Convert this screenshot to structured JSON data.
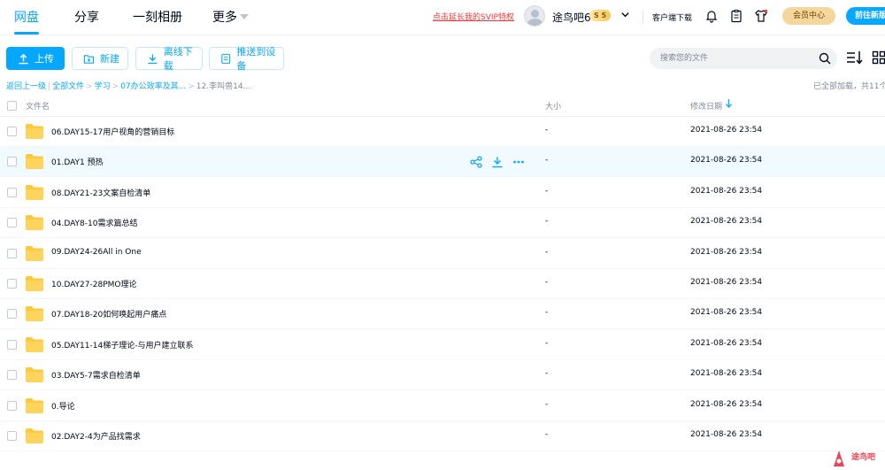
{
  "nav": {
    "items": [
      "网盘",
      "分享",
      "一刻相册",
      "更多"
    ],
    "promo": "点击延长我的SVIP特权",
    "username": "途鸟吧6",
    "vip_level": "5",
    "client_download": "客户端下载",
    "member_center": "会员中心",
    "go": "前往新版"
  },
  "toolbar": {
    "upload": "上传",
    "new": "新建",
    "offline": "离线下载",
    "push": "推送到设备",
    "search_placeholder": "搜索您的文件"
  },
  "breadcrumb": {
    "back": "返回上一级",
    "items": [
      "全部文件",
      "学习",
      "07办公效率及其..."
    ],
    "current": "12.李叫兽14...",
    "loaded": "已全部加载，共11个"
  },
  "table": {
    "headers": {
      "name": "文件名",
      "size": "大小",
      "date": "修改日期"
    },
    "rows": [
      {
        "name": "06.DAY15-17用户视角的营销目标",
        "size": "-",
        "date": "2021-08-26 23:54"
      },
      {
        "name": "01.DAY1 预热",
        "size": "-",
        "date": "2021-08-26 23:54"
      },
      {
        "name": "08.DAY21-23文案自检清单",
        "size": "-",
        "date": "2021-08-26 23:54"
      },
      {
        "name": "04.DAY8-10需求篇总结",
        "size": "-",
        "date": "2021-08-26 23:54"
      },
      {
        "name": "09.DAY24-26All in One",
        "size": "-",
        "date": "2021-08-26 23:54"
      },
      {
        "name": "10.DAY27-28PMO理论",
        "size": "-",
        "date": "2021-08-26 23:54"
      },
      {
        "name": "07.DAY18-20如何唤起用户痛点",
        "size": "-",
        "date": "2021-08-26 23:54"
      },
      {
        "name": "05.DAY11-14梯子理论-与用户建立联系",
        "size": "-",
        "date": "2021-08-26 23:54"
      },
      {
        "name": "03.DAY5-7需求自检清单",
        "size": "-",
        "date": "2021-08-26 23:54"
      },
      {
        "name": "0.导论",
        "size": "-",
        "date": "2021-08-26 23:54"
      },
      {
        "name": "02.DAY2-4为产品找需求",
        "size": "-",
        "date": "2021-08-26 23:54"
      }
    ]
  },
  "watermark": "途鸟吧",
  "colors": {
    "accent": "#06a7ff",
    "folder": "#ffc93c",
    "promo": "#ff3333",
    "member": "#f5d79e"
  }
}
